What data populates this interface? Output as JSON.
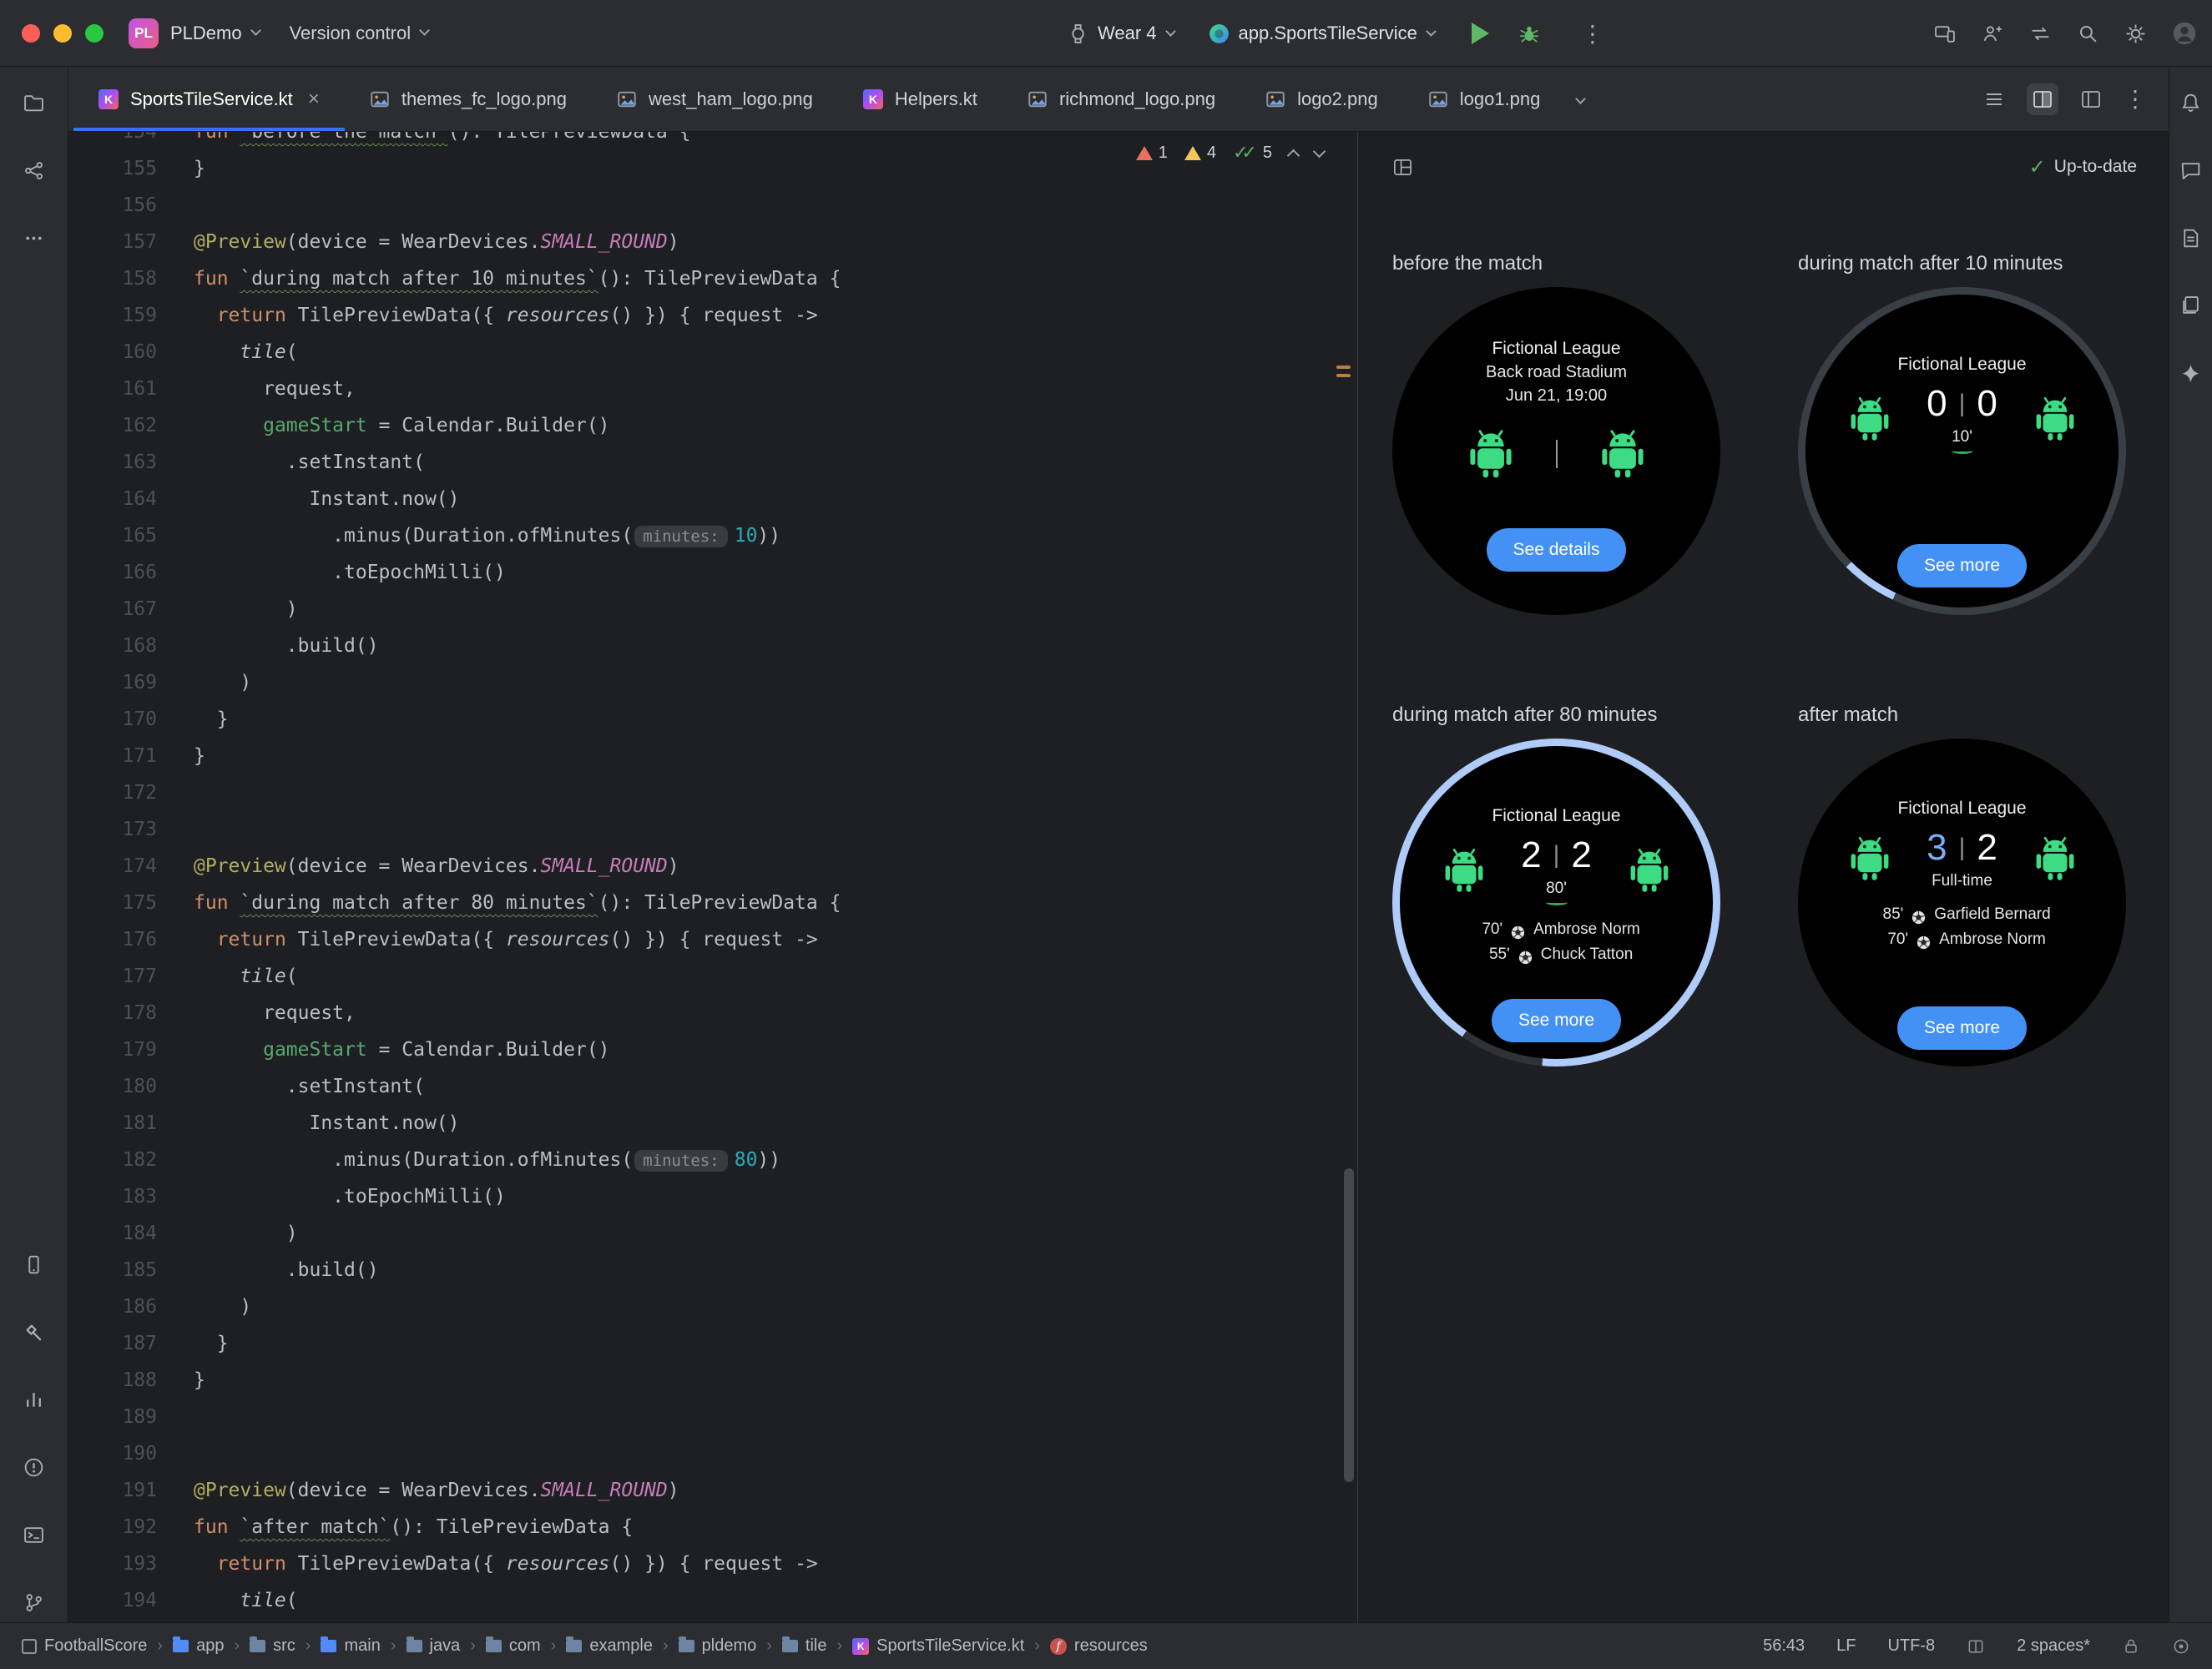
{
  "titlebar": {
    "project_badge": "PL",
    "project_name": "PLDemo",
    "vcs_widget": "Version control",
    "device_selector": "Wear 4",
    "run_config": "app.SportsTileService"
  },
  "tabbar": {
    "tabs": [
      {
        "label": "SportsTileService.kt",
        "icon": "kotlin",
        "active": true
      },
      {
        "label": "themes_fc_logo.png",
        "icon": "image",
        "active": false
      },
      {
        "label": "west_ham_logo.png",
        "icon": "image",
        "active": false
      },
      {
        "label": "Helpers.kt",
        "icon": "kotlin",
        "active": false
      },
      {
        "label": "richmond_logo.png",
        "icon": "image",
        "active": false
      },
      {
        "label": "logo2.png",
        "icon": "image",
        "active": false
      },
      {
        "label": "logo1.png",
        "icon": "image",
        "active": false
      }
    ]
  },
  "editor": {
    "inspection_widget": {
      "errors": "1",
      "warnings": "4",
      "passed": "5"
    },
    "code_lines": [
      {
        "n": "154",
        "s": [
          [
            "kw",
            "fun "
          ],
          [
            "wfn",
            "`before the match`"
          ],
          [
            "pl",
            "(): TilePreviewData {"
          ]
        ]
      },
      {
        "n": "155",
        "s": [
          [
            "pl",
            "}"
          ]
        ]
      },
      {
        "n": "156",
        "s": []
      },
      {
        "n": "157",
        "s": [
          [
            "ann",
            "@Preview"
          ],
          [
            "pl",
            "(device = WearDevices."
          ],
          [
            "const",
            "SMALL_ROUND"
          ],
          [
            "pl",
            ")"
          ]
        ]
      },
      {
        "n": "158",
        "s": [
          [
            "kw",
            "fun "
          ],
          [
            "wfn",
            "`during match after 10 minutes`"
          ],
          [
            "pl",
            "(): TilePreviewData {"
          ]
        ]
      },
      {
        "n": "159",
        "s": [
          [
            "pl",
            "  "
          ],
          [
            "kw",
            "return"
          ],
          [
            "pl",
            " TilePreviewData({ "
          ],
          [
            "it",
            "resources"
          ],
          [
            "pl",
            "() }) { request ->"
          ]
        ]
      },
      {
        "n": "160",
        "s": [
          [
            "pl",
            "    "
          ],
          [
            "it",
            "tile"
          ],
          [
            "pl",
            "("
          ]
        ]
      },
      {
        "n": "161",
        "s": [
          [
            "pl",
            "      request,"
          ]
        ]
      },
      {
        "n": "162",
        "s": [
          [
            "pl",
            "      "
          ],
          [
            "narg",
            "gameStart"
          ],
          [
            "pl",
            " = Calendar.Builder()"
          ]
        ]
      },
      {
        "n": "163",
        "s": [
          [
            "pl",
            "        .setInstant("
          ]
        ]
      },
      {
        "n": "164",
        "s": [
          [
            "pl",
            "          Instant.now()"
          ]
        ]
      },
      {
        "n": "165",
        "s": [
          [
            "pl",
            "            .minus(Duration.ofMinutes("
          ],
          [
            "hint",
            "minutes:"
          ],
          [
            "num",
            "10"
          ],
          [
            "pl",
            "))"
          ]
        ]
      },
      {
        "n": "166",
        "s": [
          [
            "pl",
            "            .toEpochMilli()"
          ]
        ]
      },
      {
        "n": "167",
        "s": [
          [
            "pl",
            "        )"
          ]
        ]
      },
      {
        "n": "168",
        "s": [
          [
            "pl",
            "        .build()"
          ]
        ]
      },
      {
        "n": "169",
        "s": [
          [
            "pl",
            "    )"
          ]
        ]
      },
      {
        "n": "170",
        "s": [
          [
            "pl",
            "  }"
          ]
        ]
      },
      {
        "n": "171",
        "s": [
          [
            "pl",
            "}"
          ]
        ]
      },
      {
        "n": "172",
        "s": []
      },
      {
        "n": "173",
        "s": []
      },
      {
        "n": "174",
        "s": [
          [
            "ann",
            "@Preview"
          ],
          [
            "pl",
            "(device = WearDevices."
          ],
          [
            "const",
            "SMALL_ROUND"
          ],
          [
            "pl",
            ")"
          ]
        ]
      },
      {
        "n": "175",
        "s": [
          [
            "kw",
            "fun "
          ],
          [
            "wfn",
            "`during match after 80 minutes`"
          ],
          [
            "pl",
            "(): TilePreviewData {"
          ]
        ]
      },
      {
        "n": "176",
        "s": [
          [
            "pl",
            "  "
          ],
          [
            "kw",
            "return"
          ],
          [
            "pl",
            " TilePreviewData({ "
          ],
          [
            "it",
            "resources"
          ],
          [
            "pl",
            "() }) { request ->"
          ]
        ]
      },
      {
        "n": "177",
        "s": [
          [
            "pl",
            "    "
          ],
          [
            "it",
            "tile"
          ],
          [
            "pl",
            "("
          ]
        ]
      },
      {
        "n": "178",
        "s": [
          [
            "pl",
            "      request,"
          ]
        ]
      },
      {
        "n": "179",
        "s": [
          [
            "pl",
            "      "
          ],
          [
            "narg",
            "gameStart"
          ],
          [
            "pl",
            " = Calendar.Builder()"
          ]
        ]
      },
      {
        "n": "180",
        "s": [
          [
            "pl",
            "        .setInstant("
          ]
        ]
      },
      {
        "n": "181",
        "s": [
          [
            "pl",
            "          Instant.now()"
          ]
        ]
      },
      {
        "n": "182",
        "s": [
          [
            "pl",
            "            .minus(Duration.ofMinutes("
          ],
          [
            "hint",
            "minutes:"
          ],
          [
            "num",
            "80"
          ],
          [
            "pl",
            "))"
          ]
        ]
      },
      {
        "n": "183",
        "s": [
          [
            "pl",
            "            .toEpochMilli()"
          ]
        ]
      },
      {
        "n": "184",
        "s": [
          [
            "pl",
            "        )"
          ]
        ]
      },
      {
        "n": "185",
        "s": [
          [
            "pl",
            "        .build()"
          ]
        ]
      },
      {
        "n": "186",
        "s": [
          [
            "pl",
            "    )"
          ]
        ]
      },
      {
        "n": "187",
        "s": [
          [
            "pl",
            "  }"
          ]
        ]
      },
      {
        "n": "188",
        "s": [
          [
            "pl",
            "}"
          ]
        ]
      },
      {
        "n": "189",
        "s": []
      },
      {
        "n": "190",
        "s": []
      },
      {
        "n": "191",
        "s": [
          [
            "ann",
            "@Preview"
          ],
          [
            "pl",
            "(device = WearDevices."
          ],
          [
            "const",
            "SMALL_ROUND"
          ],
          [
            "pl",
            ")"
          ]
        ]
      },
      {
        "n": "192",
        "s": [
          [
            "kw",
            "fun "
          ],
          [
            "wfn",
            "`after match`"
          ],
          [
            "pl",
            "(): TilePreviewData {"
          ]
        ]
      },
      {
        "n": "193",
        "s": [
          [
            "pl",
            "  "
          ],
          [
            "kw",
            "return"
          ],
          [
            "pl",
            " TilePreviewData({ "
          ],
          [
            "it",
            "resources"
          ],
          [
            "pl",
            "() }) { request ->"
          ]
        ]
      },
      {
        "n": "194",
        "s": [
          [
            "pl",
            "    "
          ],
          [
            "it",
            "tile"
          ],
          [
            "pl",
            "("
          ]
        ]
      }
    ]
  },
  "preview": {
    "status_label": "Up-to-date",
    "watches": {
      "w1": {
        "label": "before the match",
        "league": "Fictional League",
        "stadium": "Back road Stadium",
        "datetime": "Jun 21, 19:00",
        "button": "See details"
      },
      "w2": {
        "label": "during match after 10 minutes",
        "league": "Fictional League",
        "home_score": "0",
        "away_score": "0",
        "minute": "10'",
        "button": "See more"
      },
      "w3": {
        "label": "during match after 80 minutes",
        "league": "Fictional League",
        "home_score": "2",
        "away_score": "2",
        "minute": "80'",
        "scorers": [
          {
            "time": "70'",
            "name": "Ambrose Norm"
          },
          {
            "time": "55'",
            "name": "Chuck Tatton"
          }
        ],
        "button": "See more"
      },
      "w4": {
        "label": "after match",
        "league": "Fictional League",
        "home_score": "3",
        "away_score": "2",
        "minute": "Full-time",
        "scorers": [
          {
            "time": "85'",
            "name": "Garfield Bernard"
          },
          {
            "time": "70'",
            "name": "Ambrose Norm"
          }
        ],
        "button": "See more"
      }
    }
  },
  "statusbar": {
    "breadcrumbs": [
      {
        "label": "FootballScore",
        "icon": "project"
      },
      {
        "label": "app",
        "icon": "folder-blue"
      },
      {
        "label": "src",
        "icon": "folder"
      },
      {
        "label": "main",
        "icon": "folder-blue"
      },
      {
        "label": "java",
        "icon": "folder"
      },
      {
        "label": "com",
        "icon": "folder"
      },
      {
        "label": "example",
        "icon": "folder"
      },
      {
        "label": "pldemo",
        "icon": "folder"
      },
      {
        "label": "tile",
        "icon": "folder"
      },
      {
        "label": "SportsTileService.kt",
        "icon": "kotlin"
      },
      {
        "label": "resources",
        "icon": "function"
      }
    ],
    "caret_position": "56:43",
    "line_separator": "LF",
    "encoding": "UTF-8",
    "indent": "2 spaces*"
  }
}
